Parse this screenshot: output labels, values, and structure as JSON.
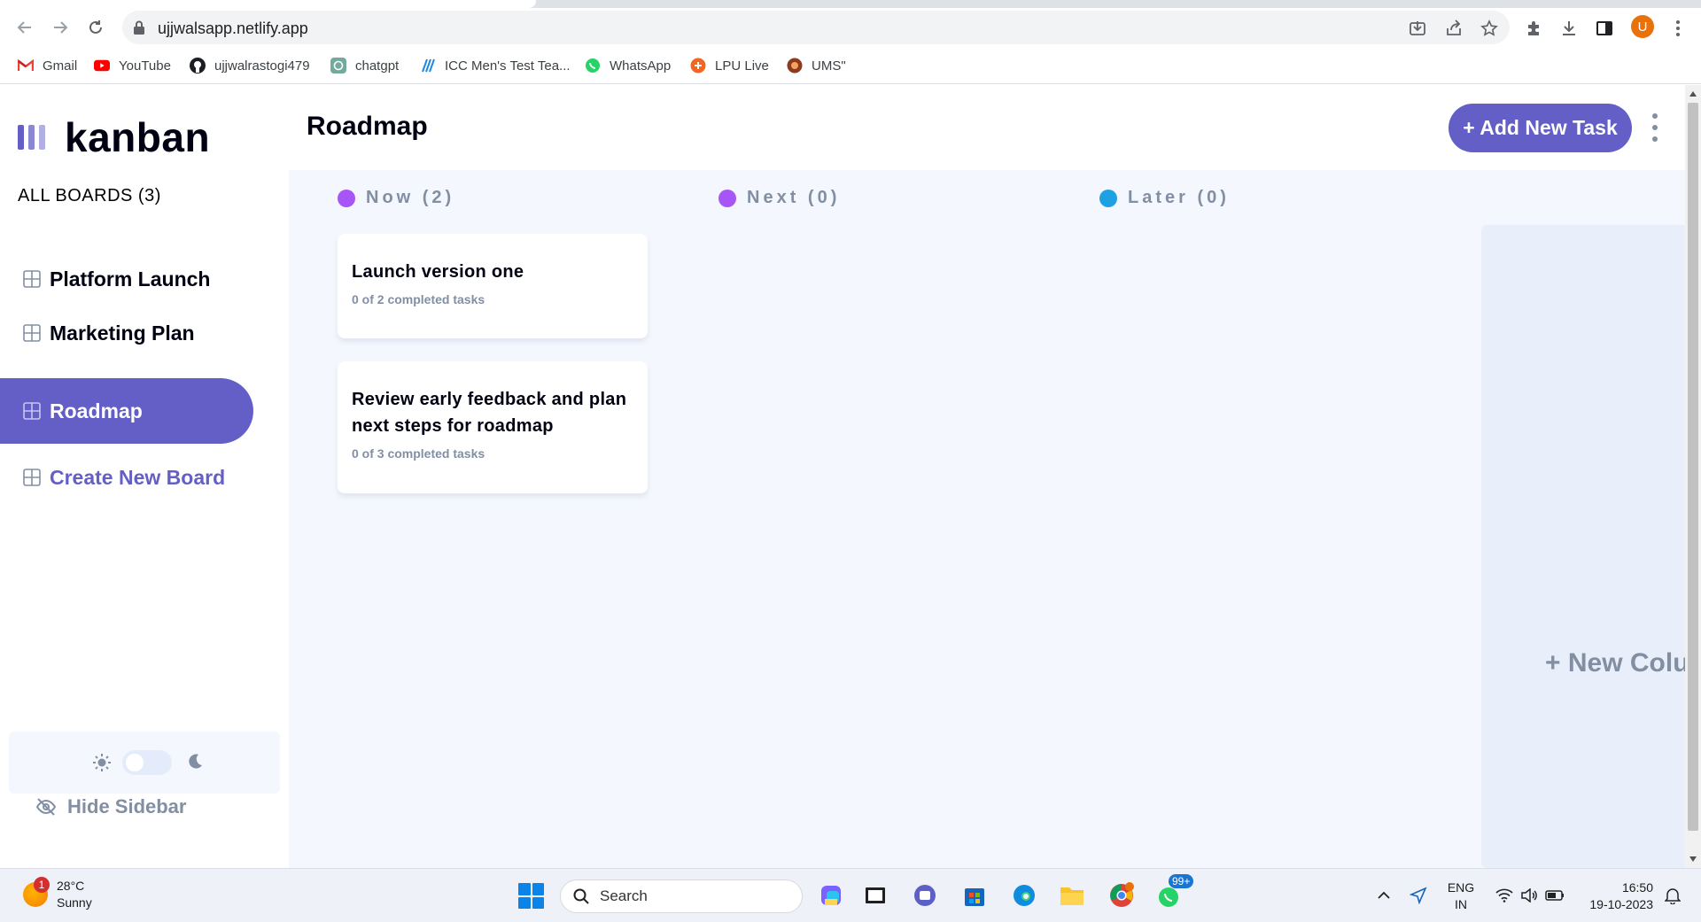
{
  "browser": {
    "url": "ujjwalsapp.netlify.app",
    "profile_initial": "U",
    "bookmarks": [
      {
        "label": "Gmail",
        "icon": "gmail-icon"
      },
      {
        "label": "YouTube",
        "icon": "youtube-icon"
      },
      {
        "label": "ujjwalrastogi479",
        "icon": "github-icon"
      },
      {
        "label": "chatgpt",
        "icon": "chatgpt-icon"
      },
      {
        "label": "ICC Men's Test Tea...",
        "icon": "icc-icon"
      },
      {
        "label": "WhatsApp",
        "icon": "whatsapp-icon"
      },
      {
        "label": "LPU Live",
        "icon": "lpu-live-icon"
      },
      {
        "label": "UMS\"",
        "icon": "ums-icon"
      }
    ]
  },
  "sidebar": {
    "logo_text": "kanban",
    "all_boards_label": "ALL BOARDS (3)",
    "boards": [
      {
        "label": "Platform Launch",
        "active": false
      },
      {
        "label": "Marketing Plan",
        "active": false
      },
      {
        "label": "Roadmap",
        "active": true
      }
    ],
    "create_board_label": "Create New Board",
    "hide_sidebar_label": "Hide Sidebar",
    "theme": "light"
  },
  "header": {
    "board_title": "Roadmap",
    "add_task_label": "+ Add New Task"
  },
  "columns": [
    {
      "label": "Now (2)",
      "dot_color": "#a855f7",
      "tasks": [
        {
          "title": "Launch version one",
          "subtitle": "0 of 2 completed tasks"
        },
        {
          "title": "Review early feedback and plan next steps for roadmap",
          "subtitle": "0 of 3 completed tasks"
        }
      ]
    },
    {
      "label": "Next (0)",
      "dot_color": "#a855f7",
      "tasks": []
    },
    {
      "label": "Later (0)",
      "dot_color": "#1ea1e3",
      "tasks": []
    }
  ],
  "new_column_label": "+ New Colu",
  "colors": {
    "accent": "#635fc7",
    "board_bg": "#f4f7fd",
    "muted_text": "#828fa3"
  },
  "taskbar": {
    "weather_temp": "28°C",
    "weather_desc": "Sunny",
    "weather_badge": "1",
    "search_placeholder": "Search",
    "whatsapp_badge": "99+",
    "language_line1": "ENG",
    "language_line2": "IN",
    "time": "16:50",
    "date": "19-10-2023"
  }
}
